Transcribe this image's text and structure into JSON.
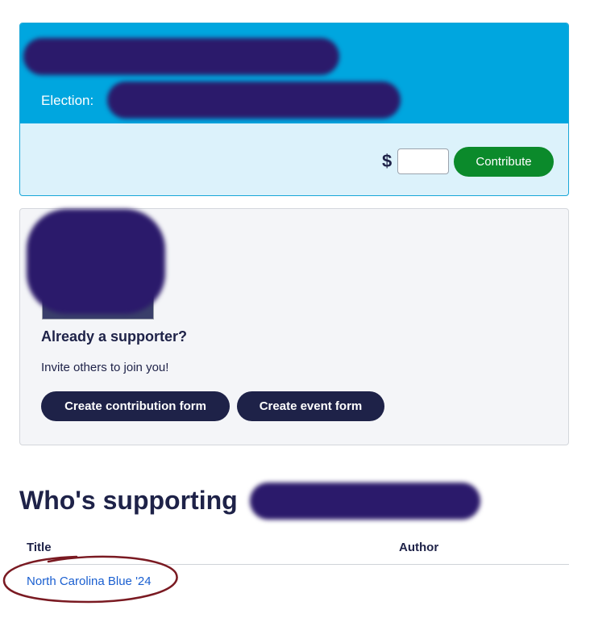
{
  "candidate_card": {
    "election_label": "Election:",
    "currency_symbol": "$",
    "amount_value": "",
    "contribute_label": "Contribute"
  },
  "supporter_card": {
    "title": "Already a supporter?",
    "subtitle": "Invite others to join you!",
    "create_contribution_form_label": "Create contribution form",
    "create_event_form_label": "Create event form"
  },
  "supporters_section": {
    "title": "Who's supporting",
    "columns": [
      "Title",
      "Author"
    ],
    "rows": [
      {
        "title": "North Carolina Blue '24",
        "author": ""
      }
    ]
  },
  "colors": {
    "header_blue": "#00a6df",
    "card_light_blue": "#dcf2fb",
    "contribute_green": "#0b8a2b",
    "navy": "#1e2248",
    "link_blue": "#1a5fd0",
    "annotation_red": "#7a1a22",
    "redaction": "#2b1a6b"
  }
}
